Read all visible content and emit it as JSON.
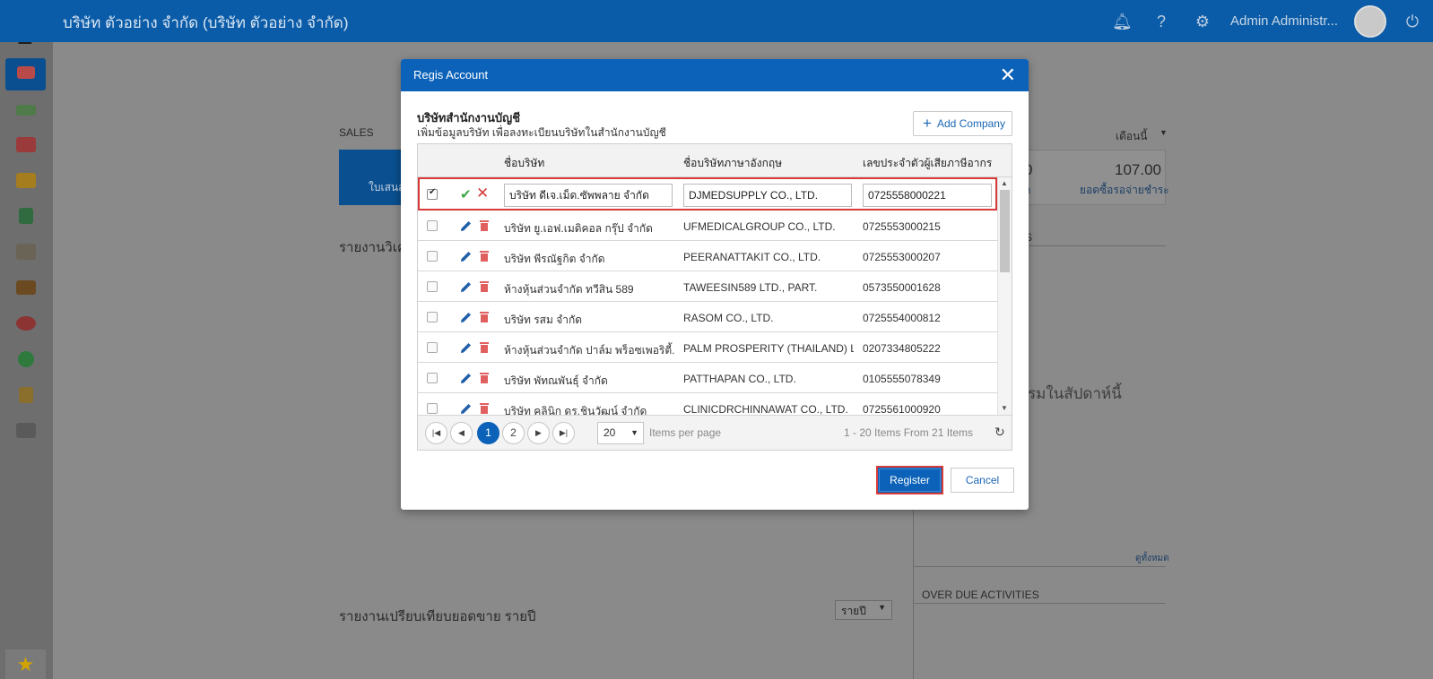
{
  "app": {
    "company_title": "บริษัท ตัวอย่าง จำกัด (บริษัท ตัวอย่าง จำกัด)",
    "user_name": "Admin Administr...",
    "colors": {
      "primary": "#0b62b8",
      "highlight": "#d93a3a"
    }
  },
  "background": {
    "sales_label": "SALES",
    "card_text_left": "ใบเสนอ",
    "report_label_left": "รายงานวิเค",
    "month_filter": "เดือนนี้",
    "metric_value": "107.00",
    "metric_caption": "ยอดซื้อรอจ่ายชำระ",
    "metric_partial_value": "0",
    "metric_partial_caption": "ก",
    "side_header_partial": "S",
    "no_activity_text": "รมในสัปดาห์นี้",
    "view_all": "ดูทั้งหมด",
    "overdue_title": "OVER DUE ACTIVITIES",
    "yearly_report": "รายงานเปรียบเทียบยอดขาย รายปี",
    "year_filter": "รายปี"
  },
  "modal": {
    "title": "Regis Account",
    "section_title": "บริษัทสำนักงานบัญชี",
    "section_subtitle": "เพิ่มข้อมูลบริษัท เพื่อลงทะเบียนบริษัทในสำนักงานบัญชี",
    "add_company_label": "Add Company",
    "columns": [
      "ชื่อบริษัท",
      "ชื่อบริษัทภาษาอังกฤษ",
      "เลขประจำตัวผู้เสียภาษีอากร"
    ],
    "editing_row": {
      "name_th": "บริษัท ดีเจ.เม็ด.ซัพพลาย จำกัด",
      "name_en": "DJMEDSUPPLY CO., LTD.",
      "tax_id": "0725558000221"
    },
    "rows": [
      {
        "name_th": "บริษัท ยู.เอฟ.เมดิคอล กรุ๊ป จำกัด",
        "name_en": "UFMEDICALGROUP CO., LTD.",
        "tax_id": "0725553000215"
      },
      {
        "name_th": "บริษัท พีรณัฐกิต จำกัด",
        "name_en": "PEERANATTAKIT CO., LTD.",
        "tax_id": "0725553000207"
      },
      {
        "name_th": "ห้างหุ้นส่วนจำกัด ทวีสิน 589",
        "name_en": "TAWEESIN589 LTD., PART.",
        "tax_id": "0573550001628"
      },
      {
        "name_th": "บริษัท รสม จำกัด",
        "name_en": "RASOM CO., LTD.",
        "tax_id": "0725554000812"
      },
      {
        "name_th": "ห้างหุ้นส่วนจำกัด ปาล์ม พร็อซเพอริตี้...",
        "name_en": "PALM PROSPERITY (THAILAND) L...",
        "tax_id": "0207334805222"
      },
      {
        "name_th": "บริษัท พัทณพันธุ์ จำกัด",
        "name_en": "PATTHAPAN CO., LTD.",
        "tax_id": "0105555078349"
      },
      {
        "name_th": "บริษัท คลินิก ดร.ชินวัฒน์ จำกัด",
        "name_en": "CLINICDRCHINNAWAT CO., LTD.",
        "tax_id": "0725561000920"
      }
    ],
    "pager": {
      "pages": [
        "1",
        "2"
      ],
      "page_size": "20",
      "items_per_page": "Items per page",
      "summary": "1 - 20 Items From 21 Items"
    },
    "register_label": "Register",
    "cancel_label": "Cancel"
  }
}
